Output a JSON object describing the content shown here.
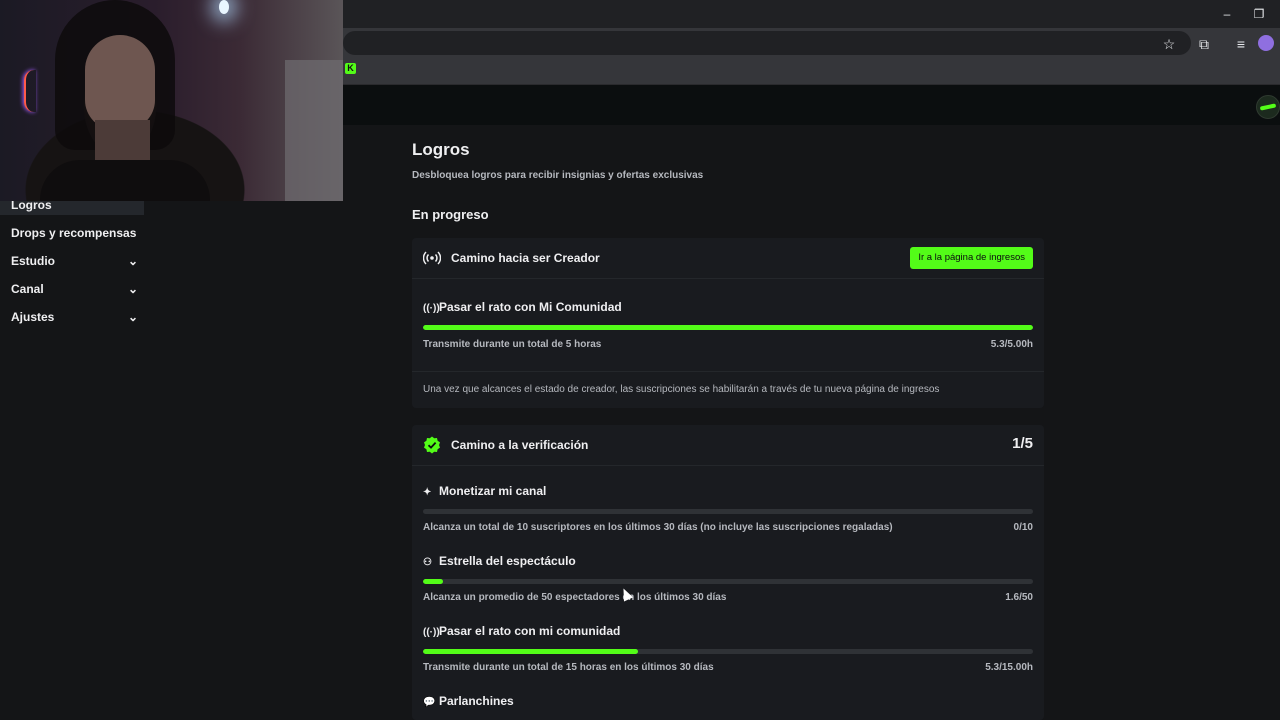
{
  "browser": {
    "window_controls": {
      "minimize": "–",
      "restore": "❐"
    },
    "icons": [
      "star-icon",
      "extensions-icon",
      "media-icon",
      "profile-icon"
    ],
    "favicon_letter": "K"
  },
  "sidebar": {
    "items": [
      {
        "label": "Logros",
        "active": true
      },
      {
        "label": "Drops y recompensas"
      },
      {
        "label": "Estudio",
        "expandable": true
      },
      {
        "label": "Canal",
        "expandable": true
      },
      {
        "label": "Ajustes",
        "expandable": true
      }
    ]
  },
  "page": {
    "title": "Logros",
    "subtitle": "Desbloquea logros para recibir insignias y ofertas exclusivas",
    "section": "En progreso"
  },
  "creator_card": {
    "title": "Camino hacia ser Creador",
    "button_label": "Ir a la página de ingresos",
    "task": {
      "title": "Pasar el rato con Mi Comunidad",
      "description": "Transmite durante un total de 5 horas",
      "value": "5.3/5.00h",
      "progress": 1.0
    },
    "note": "Una vez que alcances el estado de creador, las suscripciones se habilitarán a través de tu nueva página de ingresos"
  },
  "verification_card": {
    "title": "Camino a la verificación",
    "count": "1/5",
    "tasks": [
      {
        "title": "Monetizar mi canal",
        "icon": "sparkle-icon",
        "description": "Alcanza un total de 10 suscriptores en los últimos 30 días (no incluye las suscripciones regaladas)",
        "value": "0/10",
        "progress": 0.0
      },
      {
        "title": "Estrella del espectáculo",
        "icon": "users-icon",
        "description": "Alcanza un promedio de 50 espectadores en los últimos 30 días",
        "value": "1.6/50",
        "progress": 0.032
      },
      {
        "title": "Pasar el rato con mi comunidad",
        "icon": "broadcast-icon",
        "description": "Transmite durante un total de 15 horas en los últimos 30 días",
        "value": "5.3/15.00h",
        "progress": 0.353
      },
      {
        "title": "Parlanchines",
        "icon": "chat-icon"
      }
    ]
  },
  "colors": {
    "accent": "#53fc18",
    "background": "#141517",
    "card": "#191b1f"
  }
}
